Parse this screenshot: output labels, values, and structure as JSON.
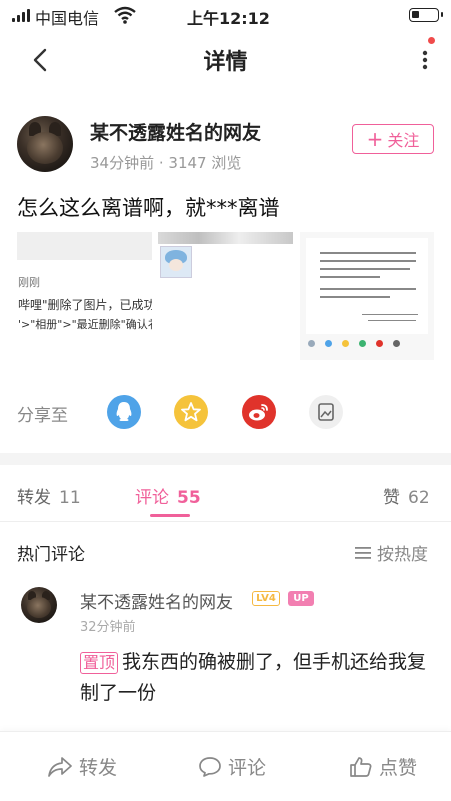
{
  "status_bar": {
    "carrier": "中国电信",
    "time": "上午12:12",
    "battery_level": 0.3
  },
  "nav": {
    "title": "详情"
  },
  "author": {
    "name": "某不透露姓名的网友",
    "time_ago": "34分钟前",
    "views": "3147 浏览",
    "follow_label": "关注"
  },
  "post": {
    "text": "怎么这么离谱啊，就***离谱"
  },
  "images": {
    "img1_text_1": "刚刚",
    "img1_text_2": "哔哩\"删除了图片，已成功",
    "img1_text_3": "'>\"相册\">\"最近删除\"确认衤"
  },
  "share": {
    "label": "分享至",
    "targets": [
      "qq-icon",
      "qzone-icon",
      "weibo-icon",
      "poster-icon"
    ]
  },
  "tabs": [
    {
      "label": "转发",
      "count": "11"
    },
    {
      "label": "评论",
      "count": "55"
    },
    {
      "label": "赞",
      "count": "62"
    }
  ],
  "comments_section": {
    "title": "热门评论",
    "sort_label": "按热度"
  },
  "comment": {
    "name": "某不透露姓名的网友",
    "level": "LV4",
    "up_badge": "UP",
    "time": "32分钟前",
    "pin_label": "置顶",
    "text": "我东西的确被删了，但手机还给我复制了一份"
  },
  "bottom_bar": {
    "repost": "转发",
    "comment": "评论",
    "like": "点赞"
  },
  "colors": {
    "accent": "#f0609a",
    "qq": "#4fa3e8",
    "qzone": "#f5c33b",
    "weibo": "#e0332b"
  }
}
